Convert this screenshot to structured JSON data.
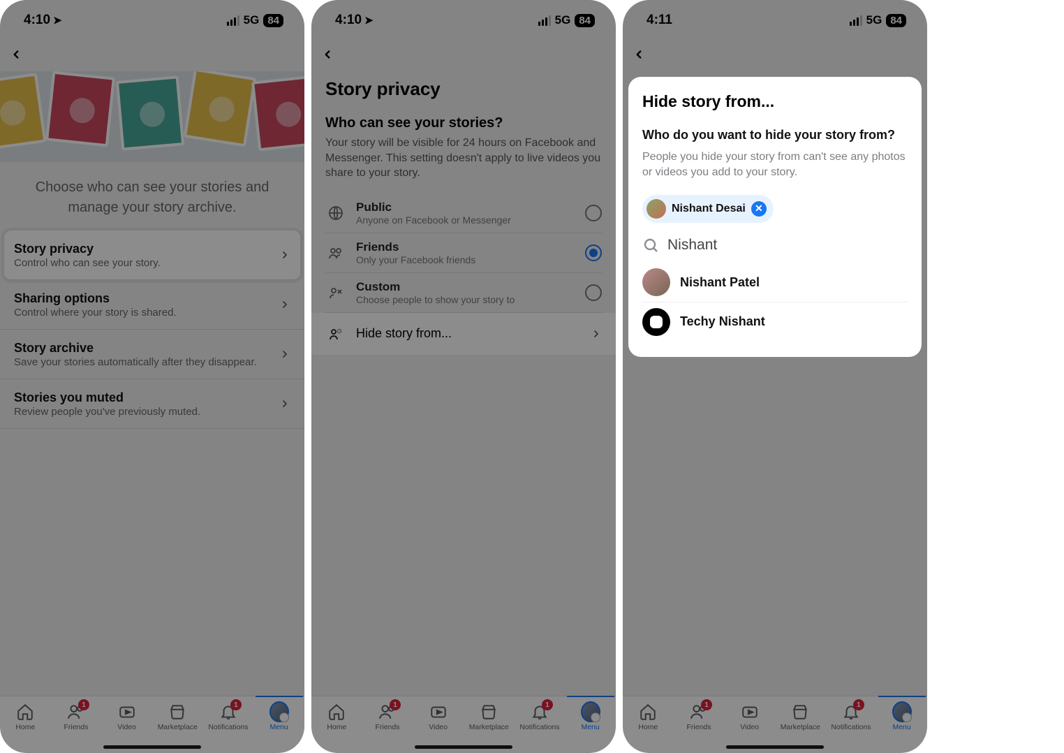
{
  "status": {
    "time_a": "4:10",
    "time_b": "4:10",
    "time_c": "4:11",
    "net": "5G",
    "batt": "84"
  },
  "screen1": {
    "intro": "Choose who can see your stories and manage your story archive.",
    "items": [
      {
        "title": "Story privacy",
        "sub": "Control who can see your story."
      },
      {
        "title": "Sharing options",
        "sub": "Control where your story is shared."
      },
      {
        "title": "Story archive",
        "sub": "Save your stories automatically after they disappear."
      },
      {
        "title": "Stories you muted",
        "sub": "Review people you've previously muted."
      }
    ]
  },
  "screen2": {
    "title": "Story privacy",
    "subtitle": "Who can see your stories?",
    "desc": "Your story will be visible for 24 hours on Facebook and Messenger. This setting doesn't apply to live videos you share to your story.",
    "opts": [
      {
        "title": "Public",
        "sub": "Anyone on Facebook or Messenger"
      },
      {
        "title": "Friends",
        "sub": "Only your Facebook friends"
      },
      {
        "title": "Custom",
        "sub": "Choose people to show your story to"
      },
      {
        "title": "Hide story from..."
      }
    ]
  },
  "screen3": {
    "title": "Hide story from...",
    "question": "Who do you want to hide your story from?",
    "desc": "People you hide your story from can't see any photos or videos you add to your story.",
    "chip_name": "Nishant Desai",
    "search_value": "Nishant",
    "results": [
      {
        "name": "Nishant Patel"
      },
      {
        "name": "Techy Nishant"
      }
    ]
  },
  "tabs": {
    "home": "Home",
    "friends": "Friends",
    "video": "Video",
    "marketplace": "Marketplace",
    "notifications": "Notifications",
    "menu": "Menu",
    "badge_friends": "1",
    "badge_notif": "1"
  }
}
